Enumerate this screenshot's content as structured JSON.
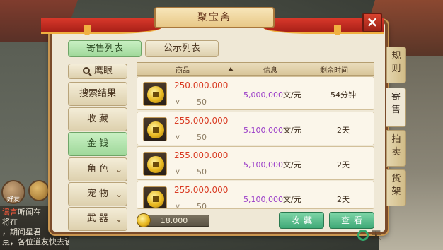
{
  "window": {
    "title": "聚宝斋"
  },
  "tabs": [
    {
      "label": "寄售列表",
      "active": true
    },
    {
      "label": "公示列表",
      "active": false
    }
  ],
  "categories": [
    {
      "label": "鹰眼",
      "icon": "magnifier-icon",
      "active": false
    },
    {
      "label": "搜索结果",
      "active": false
    },
    {
      "label": "收 藏",
      "active": false
    },
    {
      "label": "金 钱",
      "active": true
    },
    {
      "label": "角 色",
      "dropdown": true,
      "active": false
    },
    {
      "label": "宠 物",
      "dropdown": true,
      "active": false
    },
    {
      "label": "武 器",
      "dropdown": true,
      "active": false
    }
  ],
  "table": {
    "headers": {
      "item": "商品",
      "info": "信息",
      "time_left": "剩余时间"
    },
    "rows": [
      {
        "amount": "250.000.000",
        "level": "50",
        "price_num": "5,000,000",
        "price_unit": "文/元",
        "time": "54分钟"
      },
      {
        "amount": "255.000.000",
        "level": "50",
        "price_num": "5,100,000",
        "price_unit": "文/元",
        "time": "2天"
      },
      {
        "amount": "255.000.000",
        "level": "50",
        "price_num": "5,100,000",
        "price_unit": "文/元",
        "time": "2天"
      },
      {
        "amount": "255.000.000",
        "level": "50",
        "price_num": "5,100,000",
        "price_unit": "文/元",
        "time": "2天"
      }
    ]
  },
  "side_tabs": [
    {
      "label": "规则",
      "active": false
    },
    {
      "label": "寄售",
      "active": true
    },
    {
      "label": "拍卖",
      "active": false
    },
    {
      "label": "货架",
      "active": false
    }
  ],
  "footer": {
    "gold": "18.000",
    "favorite_label": "收藏",
    "view_label": "查看"
  },
  "chat": {
    "friend_label": "好友",
    "lines": [
      {
        "tag": "谣言",
        "text": "听闻在"
      },
      {
        "tag": "",
        "text": "将在"
      },
      {
        "tag": "",
        "text": "，期间星君"
      },
      {
        "tag": "",
        "text": "点，各位道友快去该地图寻找吧！"
      }
    ]
  },
  "watermark": "天",
  "colors": {
    "accent_green": "#9fd89a",
    "price_purple": "#9a3cc8",
    "amount_red": "#d93b23",
    "close_red": "#c73a28"
  }
}
